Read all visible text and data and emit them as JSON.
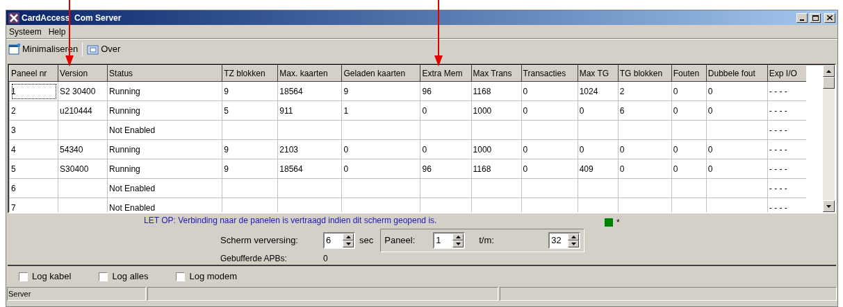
{
  "window": {
    "title": "CardAccess  Com Server"
  },
  "menu": [
    "Systeem",
    "Help"
  ],
  "toolbar": [
    "Minimaliseren",
    "Over"
  ],
  "table": {
    "columns": [
      "Paneel nr",
      "Version",
      "Status",
      "TZ blokken",
      "Max. kaarten",
      "Geladen kaarten",
      "Extra Mem",
      "Max Trans",
      "Transacties",
      "Max TG",
      "TG blokken",
      "Fouten",
      "Dubbele fout",
      "Exp I/O"
    ],
    "rows": [
      {
        "cells": [
          "1",
          "S2 30400",
          "Running",
          "9",
          "18564",
          "9",
          "96",
          "1168",
          "0",
          "1024",
          "2",
          "0",
          "0",
          "- - - -"
        ],
        "focused": true
      },
      {
        "cells": [
          "2",
          "u210444",
          "Running",
          "5",
          "911",
          "1",
          "0",
          "1000",
          "0",
          "0",
          "6",
          "0",
          "0",
          "- - - -"
        ],
        "focused": false
      },
      {
        "cells": [
          "3",
          "",
          "Not Enabled",
          "",
          "",
          "",
          "",
          "",
          "",
          "",
          "",
          "",
          "",
          "- - - -"
        ],
        "focused": false
      },
      {
        "cells": [
          "4",
          "54340",
          "Running",
          "9",
          "2103",
          "0",
          "0",
          "1000",
          "0",
          "0",
          "0",
          "0",
          "0",
          "- - - -"
        ],
        "focused": false
      },
      {
        "cells": [
          "5",
          "S30400",
          "Running",
          "9",
          "18564",
          "0",
          "96",
          "1168",
          "0",
          "409",
          "0",
          "0",
          "0",
          "- - - -"
        ],
        "focused": false
      },
      {
        "cells": [
          "6",
          "",
          "Not Enabled",
          "",
          "",
          "",
          "",
          "",
          "",
          "",
          "",
          "",
          "",
          "- - - -"
        ],
        "focused": false
      },
      {
        "cells": [
          "7",
          "",
          "Not Enabled",
          "",
          "",
          "",
          "",
          "",
          "",
          "",
          "",
          "",
          "",
          "- - - -"
        ],
        "focused": false
      }
    ]
  },
  "notice": "LET OP: Verbinding naar de panelen is vertraagd indien dit scherm geopend is.",
  "indicator": {
    "color": "#008000",
    "label": "*"
  },
  "refresh": {
    "label": "Scherm verversing:",
    "value": "6",
    "unit": "sec"
  },
  "panel_from": {
    "label": "Paneel:",
    "value": "1"
  },
  "panel_to": {
    "label": "t/m:",
    "value": "32"
  },
  "buffered": {
    "label": "Gebufferde APBs:",
    "value": "0"
  },
  "checkboxes": [
    {
      "label": "Log kabel",
      "checked": false
    },
    {
      "label": "Log alles",
      "checked": false
    },
    {
      "label": "Log modem",
      "checked": false
    }
  ],
  "status_bar": [
    "Server"
  ]
}
